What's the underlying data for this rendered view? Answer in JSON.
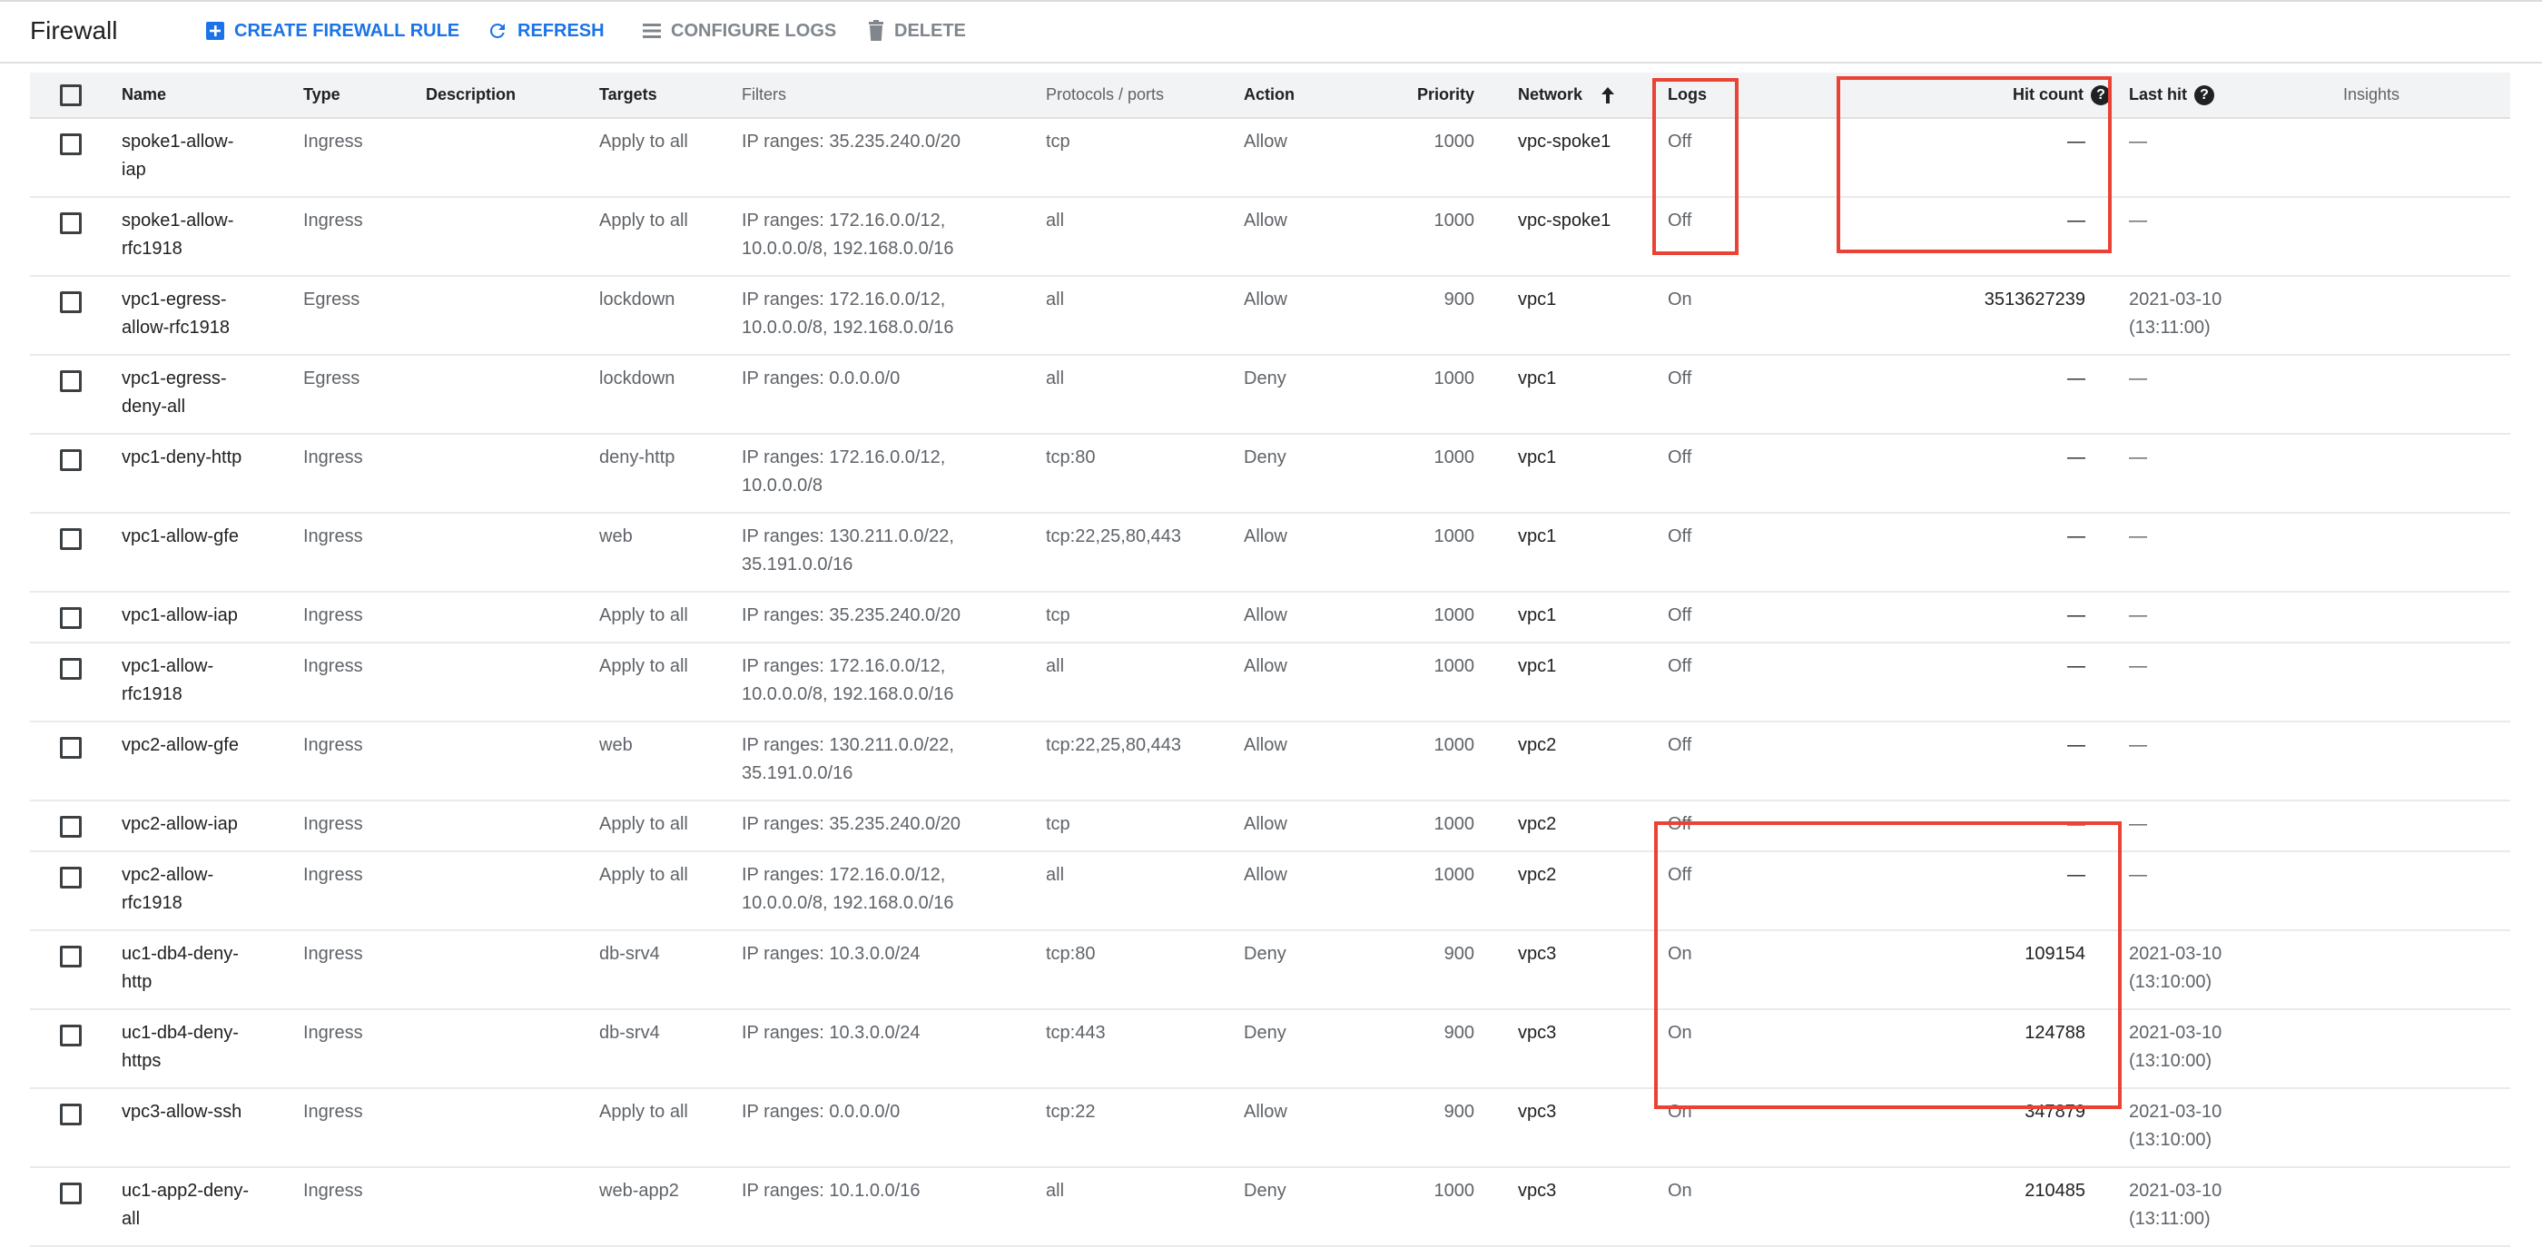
{
  "toolbar": {
    "title": "Firewall",
    "create_label": "CREATE FIREWALL RULE",
    "refresh_label": "REFRESH",
    "configure_logs_label": "CONFIGURE LOGS",
    "delete_label": "DELETE"
  },
  "colors": {
    "accent": "#1a73e8",
    "highlight": "#ea4335",
    "header_bg": "#f1f3f4",
    "muted_text": "#5f6368"
  },
  "icons": {
    "create": "add-box-icon",
    "refresh": "refresh-icon",
    "configure_logs": "list-icon",
    "delete": "trash-icon",
    "sort": "arrow-up-icon",
    "help": "help-circle-icon",
    "row_action": "chevron-up-icon"
  },
  "table": {
    "headers": {
      "name": "Name",
      "type": "Type",
      "description": "Description",
      "targets": "Targets",
      "filters": "Filters",
      "protocols": "Protocols / ports",
      "action": "Action",
      "priority": "Priority",
      "network": "Network",
      "logs": "Logs",
      "hit_count": "Hit count",
      "last_hit": "Last hit",
      "insights": "Insights"
    },
    "help_glyph": "?",
    "rows": [
      {
        "name": [
          "spoke1-allow-",
          "iap"
        ],
        "type": "Ingress",
        "description": "",
        "targets": "Apply to all",
        "filters": [
          "IP ranges: 35.235.240.0/20"
        ],
        "protocols": "tcp",
        "action": "Allow",
        "priority": "1000",
        "network": "vpc-spoke1",
        "logs": "Off",
        "hit_count": "—",
        "last_hit": [
          "—"
        ],
        "expand": false
      },
      {
        "name": [
          "spoke1-allow-",
          "rfc1918"
        ],
        "type": "Ingress",
        "description": "",
        "targets": "Apply to all",
        "filters": [
          "IP ranges: 172.16.0.0/12,",
          "10.0.0.0/8, 192.168.0.0/16"
        ],
        "protocols": "all",
        "action": "Allow",
        "priority": "1000",
        "network": "vpc-spoke1",
        "logs": "Off",
        "hit_count": "—",
        "last_hit": [
          "—"
        ],
        "expand": true
      },
      {
        "name": [
          "vpc1-egress-",
          "allow-rfc1918"
        ],
        "type": "Egress",
        "description": "",
        "targets": "lockdown",
        "filters": [
          "IP ranges: 172.16.0.0/12,",
          "10.0.0.0/8, 192.168.0.0/16"
        ],
        "protocols": "all",
        "action": "Allow",
        "priority": "900",
        "network": "vpc1",
        "logs": "On",
        "hit_count": "3513627239",
        "last_hit": [
          "2021-03-10",
          "(13:11:00)"
        ],
        "expand": true
      },
      {
        "name": [
          "vpc1-egress-",
          "deny-all"
        ],
        "type": "Egress",
        "description": "",
        "targets": "lockdown",
        "filters": [
          "IP ranges: 0.0.0.0/0"
        ],
        "protocols": "all",
        "action": "Deny",
        "priority": "1000",
        "network": "vpc1",
        "logs": "Off",
        "hit_count": "—",
        "last_hit": [
          "—"
        ],
        "expand": false
      },
      {
        "name": [
          "vpc1-deny-http"
        ],
        "type": "Ingress",
        "description": "",
        "targets": "deny-http",
        "filters": [
          "IP ranges: 172.16.0.0/12,",
          "10.0.0.0/8"
        ],
        "protocols": "tcp:80",
        "action": "Deny",
        "priority": "1000",
        "network": "vpc1",
        "logs": "Off",
        "hit_count": "—",
        "last_hit": [
          "—"
        ],
        "expand": true
      },
      {
        "name": [
          "vpc1-allow-gfe"
        ],
        "type": "Ingress",
        "description": "",
        "targets": "web",
        "filters": [
          "IP ranges: 130.211.0.0/22,",
          "35.191.0.0/16"
        ],
        "protocols": "tcp:22,25,80,443",
        "action": "Allow",
        "priority": "1000",
        "network": "vpc1",
        "logs": "Off",
        "hit_count": "—",
        "last_hit": [
          "—"
        ],
        "expand": true
      },
      {
        "name": [
          "vpc1-allow-iap"
        ],
        "type": "Ingress",
        "description": "",
        "targets": "Apply to all",
        "filters": [
          "IP ranges: 35.235.240.0/20"
        ],
        "protocols": "tcp",
        "action": "Allow",
        "priority": "1000",
        "network": "vpc1",
        "logs": "Off",
        "hit_count": "—",
        "last_hit": [
          "—"
        ],
        "expand": false
      },
      {
        "name": [
          "vpc1-allow-",
          "rfc1918"
        ],
        "type": "Ingress",
        "description": "",
        "targets": "Apply to all",
        "filters": [
          "IP ranges: 172.16.0.0/12,",
          "10.0.0.0/8, 192.168.0.0/16"
        ],
        "protocols": "all",
        "action": "Allow",
        "priority": "1000",
        "network": "vpc1",
        "logs": "Off",
        "hit_count": "—",
        "last_hit": [
          "—"
        ],
        "expand": true
      },
      {
        "name": [
          "vpc2-allow-gfe"
        ],
        "type": "Ingress",
        "description": "",
        "targets": "web",
        "filters": [
          "IP ranges: 130.211.0.0/22,",
          "35.191.0.0/16"
        ],
        "protocols": "tcp:22,25,80,443",
        "action": "Allow",
        "priority": "1000",
        "network": "vpc2",
        "logs": "Off",
        "hit_count": "—",
        "last_hit": [
          "—"
        ],
        "expand": true
      },
      {
        "name": [
          "vpc2-allow-iap"
        ],
        "type": "Ingress",
        "description": "",
        "targets": "Apply to all",
        "filters": [
          "IP ranges: 35.235.240.0/20"
        ],
        "protocols": "tcp",
        "action": "Allow",
        "priority": "1000",
        "network": "vpc2",
        "logs": "Off",
        "hit_count": "—",
        "last_hit": [
          "—"
        ],
        "expand": false
      },
      {
        "name": [
          "vpc2-allow-",
          "rfc1918"
        ],
        "type": "Ingress",
        "description": "",
        "targets": "Apply to all",
        "filters": [
          "IP ranges: 172.16.0.0/12,",
          "10.0.0.0/8, 192.168.0.0/16"
        ],
        "protocols": "all",
        "action": "Allow",
        "priority": "1000",
        "network": "vpc2",
        "logs": "Off",
        "hit_count": "—",
        "last_hit": [
          "—"
        ],
        "expand": true
      },
      {
        "name": [
          "uc1-db4-deny-",
          "http"
        ],
        "type": "Ingress",
        "description": "",
        "targets": "db-srv4",
        "filters": [
          "IP ranges: 10.3.0.0/24"
        ],
        "protocols": "tcp:80",
        "action": "Deny",
        "priority": "900",
        "network": "vpc3",
        "logs": "On",
        "hit_count": "109154",
        "last_hit": [
          "2021-03-10",
          "(13:10:00)"
        ],
        "expand": false
      },
      {
        "name": [
          "uc1-db4-deny-",
          "https"
        ],
        "type": "Ingress",
        "description": "",
        "targets": "db-srv4",
        "filters": [
          "IP ranges: 10.3.0.0/24"
        ],
        "protocols": "tcp:443",
        "action": "Deny",
        "priority": "900",
        "network": "vpc3",
        "logs": "On",
        "hit_count": "124788",
        "last_hit": [
          "2021-03-10",
          "(13:10:00)"
        ],
        "expand": false
      },
      {
        "name": [
          "vpc3-allow-ssh"
        ],
        "type": "Ingress",
        "description": "",
        "targets": "Apply to all",
        "filters": [
          "IP ranges: 0.0.0.0/0"
        ],
        "protocols": "tcp:22",
        "action": "Allow",
        "priority": "900",
        "network": "vpc3",
        "logs": "On",
        "hit_count": "347879",
        "last_hit": [
          "2021-03-10",
          "(13:10:00)"
        ],
        "expand": false
      },
      {
        "name": [
          "uc1-app2-deny-",
          "all"
        ],
        "type": "Ingress",
        "description": "",
        "targets": "web-app2",
        "filters": [
          "IP ranges: 10.1.0.0/16"
        ],
        "protocols": "all",
        "action": "Deny",
        "priority": "1000",
        "network": "vpc3",
        "logs": "On",
        "hit_count": "210485",
        "last_hit": [
          "2021-03-10",
          "(13:11:00)"
        ],
        "expand": false
      }
    ]
  }
}
